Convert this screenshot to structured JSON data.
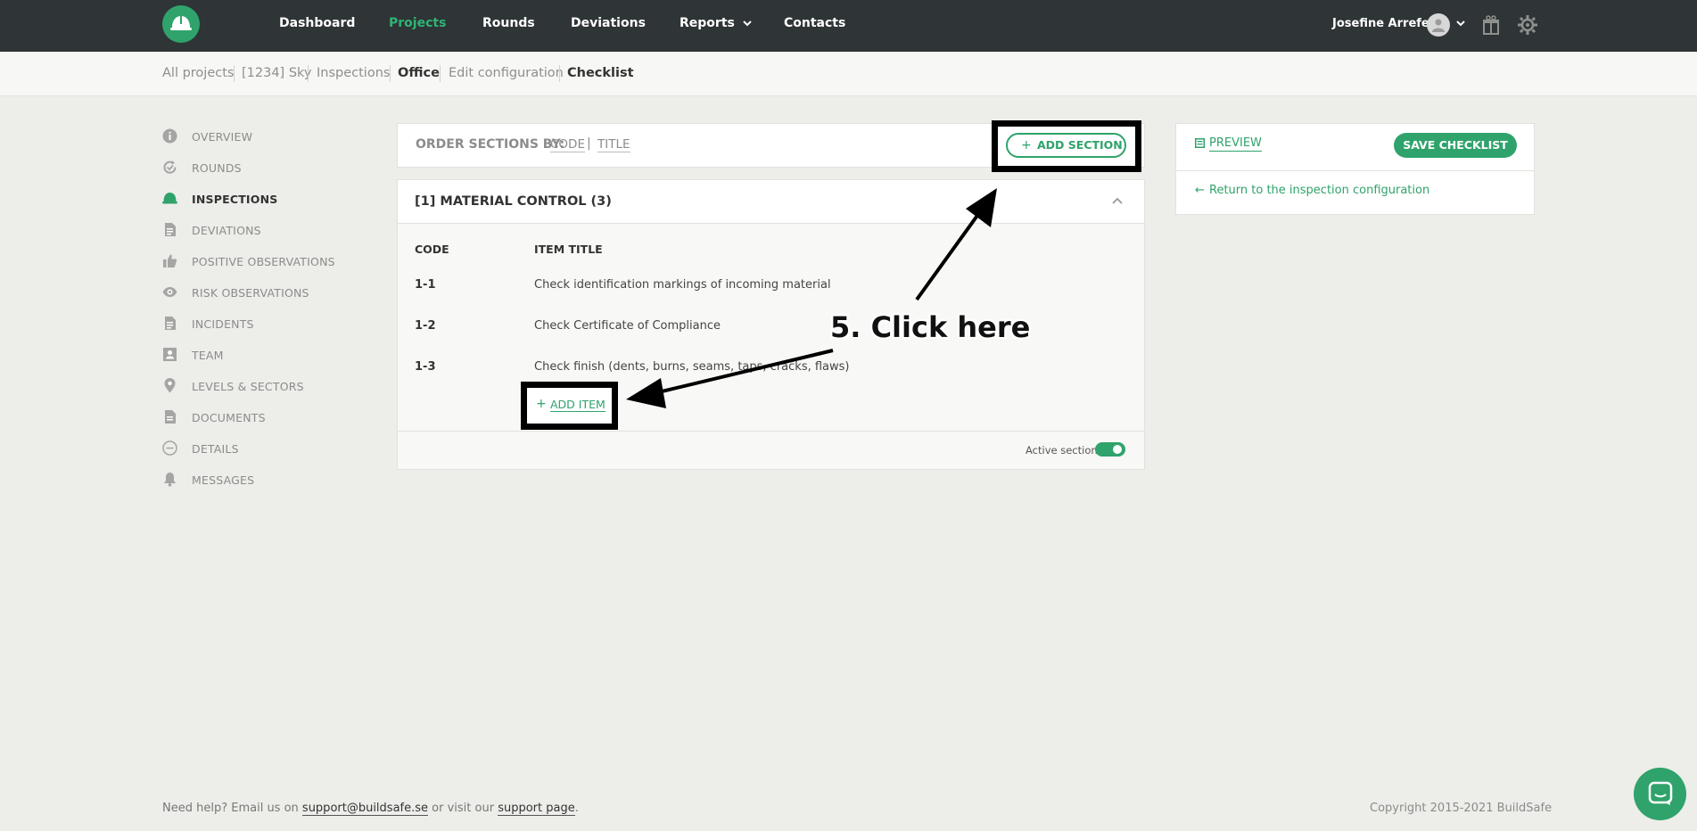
{
  "nav": {
    "items": [
      "Dashboard",
      "Projects",
      "Rounds",
      "Deviations",
      "Reports",
      "Contacts"
    ],
    "active": "Projects",
    "user_name": "Josefine Arrefelt"
  },
  "breadcrumb": [
    "All projects",
    "[1234] Sky",
    "Inspections",
    "Office",
    "Edit configuration",
    "Checklist"
  ],
  "sidebar": {
    "items": [
      {
        "label": "OVERVIEW",
        "icon": "info-icon"
      },
      {
        "label": "ROUNDS",
        "icon": "refresh-check-icon"
      },
      {
        "label": "INSPECTIONS",
        "icon": "hardhat-icon"
      },
      {
        "label": "DEVIATIONS",
        "icon": "document-icon"
      },
      {
        "label": "POSITIVE OBSERVATIONS",
        "icon": "thumbs-up-icon"
      },
      {
        "label": "RISK OBSERVATIONS",
        "icon": "eye-icon"
      },
      {
        "label": "INCIDENTS",
        "icon": "document-icon"
      },
      {
        "label": "TEAM",
        "icon": "person-card-icon"
      },
      {
        "label": "LEVELS & SECTORS",
        "icon": "map-pin-icon"
      },
      {
        "label": "DOCUMENTS",
        "icon": "file-icon"
      },
      {
        "label": "DETAILS",
        "icon": "more-circle-icon"
      },
      {
        "label": "MESSAGES",
        "icon": "bell-icon"
      }
    ],
    "active": "INSPECTIONS"
  },
  "order": {
    "label": "ORDER SECTIONS BY:",
    "options": [
      "CODE",
      "TITLE"
    ],
    "separator": "|",
    "add_section": "ADD SECTION"
  },
  "section": {
    "title": "[1] MATERIAL CONTROL (3)",
    "columns": [
      "CODE",
      "ITEM TITLE"
    ],
    "rows": [
      {
        "code": "1-1",
        "title": "Check identification markings of incoming material"
      },
      {
        "code": "1-2",
        "title": "Check Certificate of Compliance"
      },
      {
        "code": "1-3",
        "title": "Check finish (dents, burns, seams, taps, cracks, flaws)"
      }
    ],
    "add_item": "ADD ITEM",
    "active_label": "Active section",
    "active": true
  },
  "right_panel": {
    "preview": "PREVIEW",
    "save": "SAVE CHECKLIST",
    "return": "Return to the inspection configuration"
  },
  "annotation": {
    "text": "5. Click here"
  },
  "footer": {
    "help_prefix": "Need help? Email us on",
    "email": "support@buildsafe.se",
    "help_middle": "or visit our",
    "support_link": "support page",
    "help_suffix": ".",
    "copyright": "Copyright 2015-2021 BuildSafe"
  },
  "colors": {
    "accent": "#2fa36b",
    "nav_bg": "#2f3436",
    "page_bg": "#ededea"
  }
}
